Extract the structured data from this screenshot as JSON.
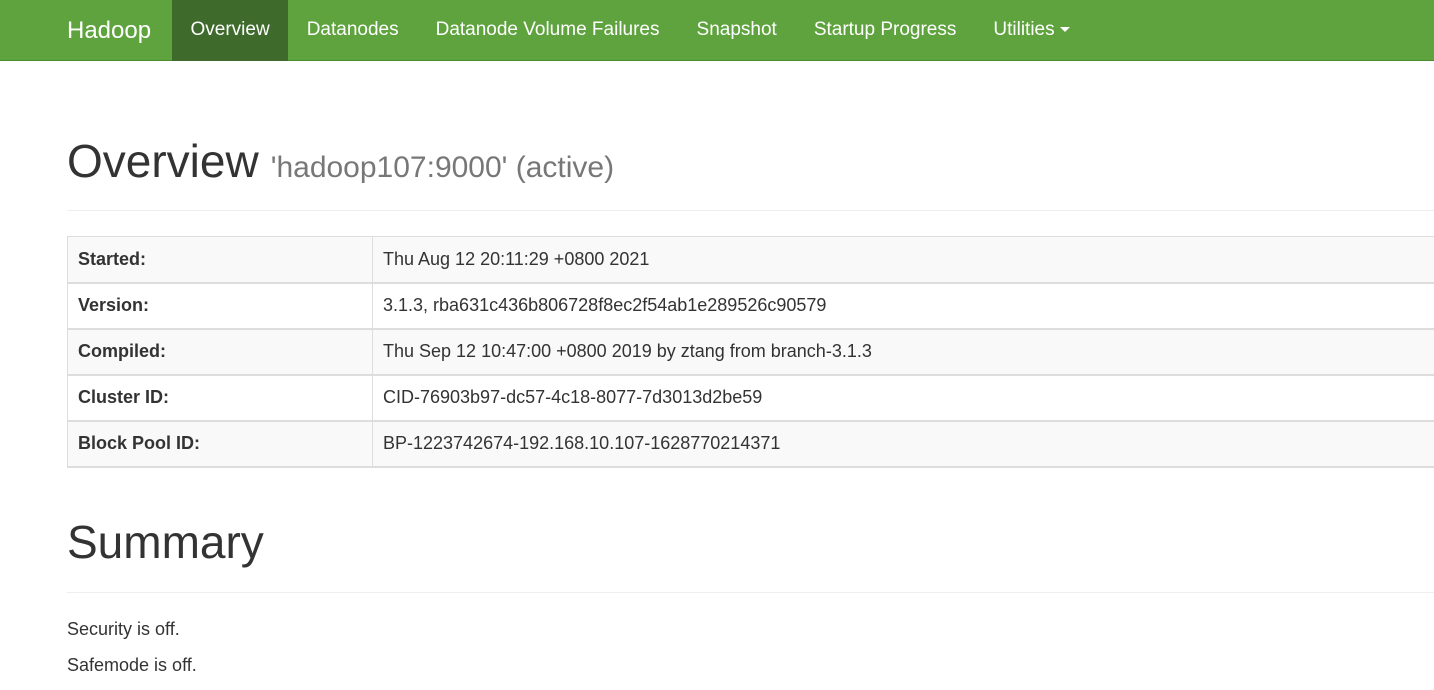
{
  "navbar": {
    "brand": "Hadoop",
    "items": [
      {
        "label": "Overview"
      },
      {
        "label": "Datanodes"
      },
      {
        "label": "Datanode Volume Failures"
      },
      {
        "label": "Snapshot"
      },
      {
        "label": "Startup Progress"
      },
      {
        "label": "Utilities"
      }
    ],
    "colors": {
      "background": "#5fa33e",
      "active": "#3e6b2c"
    }
  },
  "overview": {
    "title": "Overview",
    "subtitle": "'hadoop107:9000' (active)"
  },
  "info_table": [
    {
      "label": "Started:",
      "value": "Thu Aug 12 20:11:29 +0800 2021"
    },
    {
      "label": "Version:",
      "value": "3.1.3, rba631c436b806728f8ec2f54ab1e289526c90579"
    },
    {
      "label": "Compiled:",
      "value": "Thu Sep 12 10:47:00 +0800 2019 by ztang from branch-3.1.3"
    },
    {
      "label": "Cluster ID:",
      "value": "CID-76903b97-dc57-4c18-8077-7d3013d2be59"
    },
    {
      "label": "Block Pool ID:",
      "value": "BP-1223742674-192.168.10.107-1628770214371"
    }
  ],
  "summary": {
    "title": "Summary",
    "security": "Security is off.",
    "safemode": "Safemode is off."
  }
}
